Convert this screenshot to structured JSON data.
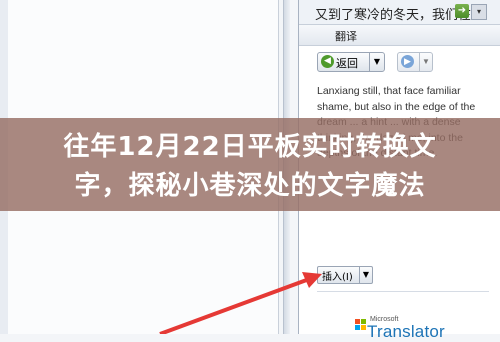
{
  "search_box": {
    "text": "又到了寒冷的冬天，我们在"
  },
  "translate_section": {
    "title": "翻译"
  },
  "toolbar": {
    "back_label": "返回",
    "back_icon": "back-arrow-icon",
    "forward_icon": "forward-arrow-icon"
  },
  "result": {
    "text": "Lanxiang still, that face familiar shame, but also in the edge of the dream ... a hint ... with a dense thinking, the dazed me, into the depths of the distant time."
  },
  "insert": {
    "label": "插入(I)"
  },
  "branding": {
    "small": "Microsoft",
    "product": "Translator"
  },
  "banner": {
    "line1": "往年12月22日平板实时转换文",
    "line2": "字，探秘小巷深处的文字魔法"
  },
  "colors": {
    "arrow": "#e53935",
    "banner": "#966e64",
    "accent": "#1d74b6"
  }
}
